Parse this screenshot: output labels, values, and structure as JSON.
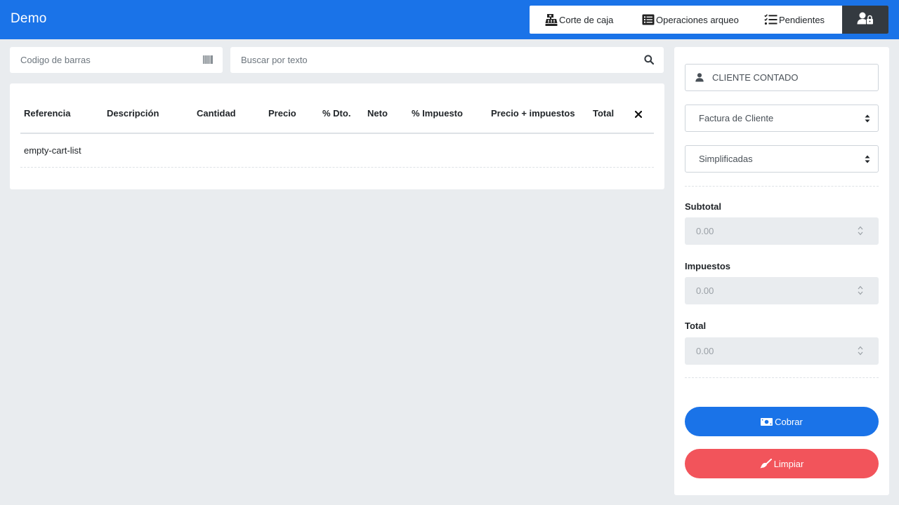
{
  "app": {
    "title": "Demo"
  },
  "nav": {
    "items": [
      {
        "label": "Corte de caja",
        "icon": "cash-register-icon"
      },
      {
        "label": "Operaciones arqueo",
        "icon": "list-alt-icon"
      },
      {
        "label": "Pendientes",
        "icon": "tasks-icon"
      }
    ],
    "user_icon": "user-lock-icon"
  },
  "search": {
    "barcode_placeholder": "Codigo de barras",
    "text_placeholder": "Buscar por texto"
  },
  "cart": {
    "columns": [
      "Referencia",
      "Descripción",
      "Cantidad",
      "Precio",
      "% Dto.",
      "Neto",
      "% Impuesto",
      "Precio + impuestos",
      "Total"
    ],
    "rows": [
      "empty-cart-list"
    ]
  },
  "panel": {
    "client": "CLIENTE CONTADO",
    "document_type": "Factura de Cliente",
    "series": "Simplificadas",
    "subtotal_label": "Subtotal",
    "subtotal_value": "0.00",
    "taxes_label": "Impuestos",
    "taxes_value": "0.00",
    "total_label": "Total",
    "total_value": "0.00",
    "pay_button": "Cobrar",
    "clear_button": "Limpiar"
  },
  "colors": {
    "primary": "#1a73e8",
    "danger": "#f2545b",
    "dark": "#343a40",
    "background": "#e9ecef"
  }
}
